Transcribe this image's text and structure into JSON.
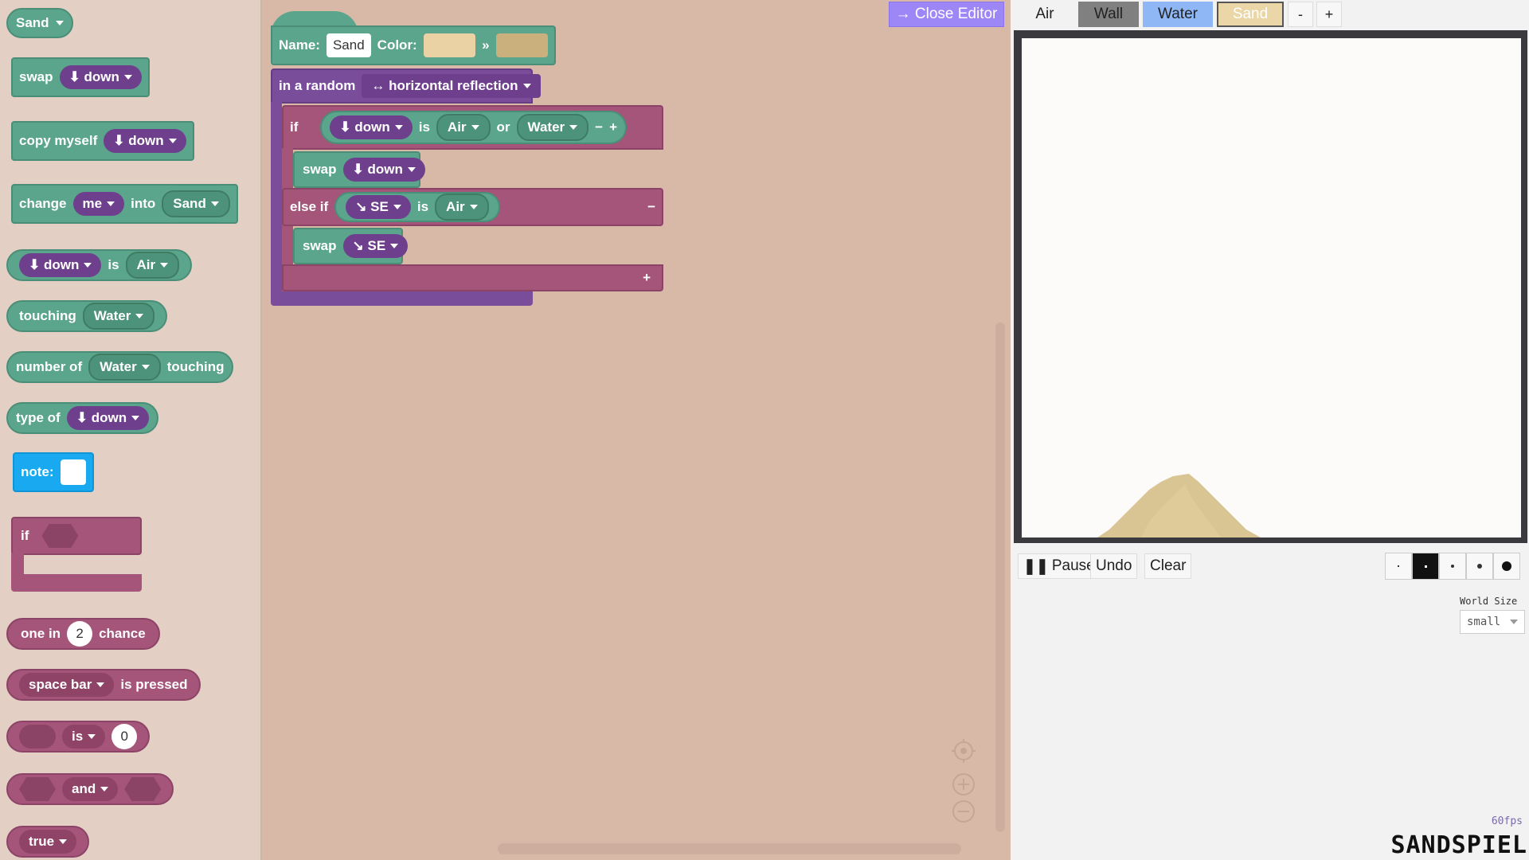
{
  "toolbox": {
    "element_select": "Sand",
    "swap": {
      "label": "swap",
      "dir": "⬇ down"
    },
    "copy": {
      "label": "copy myself",
      "dir": "⬇ down"
    },
    "change": {
      "label": "change",
      "who": "me",
      "into": "into",
      "target": "Sand"
    },
    "is_block": {
      "dir": "⬇ down",
      "is": "is",
      "target": "Air"
    },
    "touching": {
      "label": "touching",
      "target": "Water"
    },
    "number_of": {
      "label": "number of",
      "target": "Water",
      "suffix": "touching"
    },
    "type_of": {
      "label": "type of",
      "dir": "⬇ down"
    },
    "note": {
      "label": "note:"
    },
    "if_block": {
      "label": "if"
    },
    "chance": {
      "prefix": "one in",
      "value": "2",
      "suffix": "chance"
    },
    "key": {
      "key": "space bar",
      "suffix": "is pressed"
    },
    "compare": {
      "op": "is",
      "value": "0"
    },
    "and_block": {
      "op": "and"
    },
    "true_block": {
      "value": "true"
    }
  },
  "workspace": {
    "close_editor": "→ Close Editor",
    "element": {
      "name_label": "Name:",
      "name_value": "Sand",
      "color_label": "Color:",
      "arrow": "»",
      "color1": "#ead2a4",
      "color2": "#c9b07d"
    },
    "random": {
      "label": "in a random",
      "option": "↔ horizontal reflection"
    },
    "if1": {
      "label": "if",
      "dir": "⬇ down",
      "is": "is",
      "a": "Air",
      "or": "or",
      "b": "Water",
      "minus": "−",
      "plus": "+"
    },
    "swap1": {
      "label": "swap",
      "dir": "⬇ down"
    },
    "elseif": {
      "label": "else if",
      "dir": "↘ SE",
      "is": "is",
      "a": "Air",
      "minus": "−"
    },
    "swap2": {
      "label": "swap",
      "dir": "↘ SE"
    },
    "plus_end": "+"
  },
  "right": {
    "elements": [
      {
        "label": "Air",
        "color": "#f2f2f2"
      },
      {
        "label": "Wall",
        "color": "#808080"
      },
      {
        "label": "Water",
        "color": "#8fb6f5"
      },
      {
        "label": "Sand",
        "color": "#ead6a6"
      }
    ],
    "minus": "-",
    "plus": "+",
    "controls": {
      "pause": "Pause",
      "undo": "Undo",
      "clear": "Clear"
    },
    "world_size_label": "World Size",
    "world_size_value": "small",
    "fps": "60fps",
    "logo": "SANDSPIEL"
  }
}
